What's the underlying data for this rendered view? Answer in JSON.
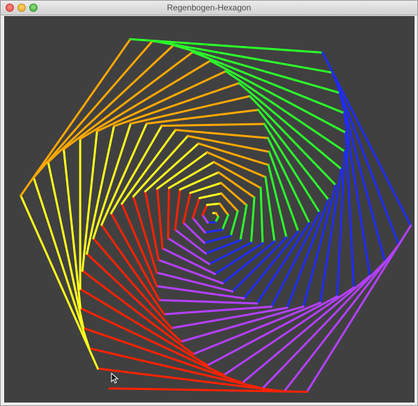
{
  "window": {
    "title": "Regenbogen-Hexagon"
  },
  "drawing": {
    "background": "#404040",
    "shape": "hexagon",
    "line_count": 120,
    "colors": [
      "#ffff1e",
      "#ffa800",
      "#2bff2b",
      "#1e2bff",
      "#b340ff",
      "#ff2200"
    ],
    "icons": [
      "close-icon",
      "minimize-icon",
      "zoom-icon",
      "mouse-pointer-icon"
    ]
  }
}
